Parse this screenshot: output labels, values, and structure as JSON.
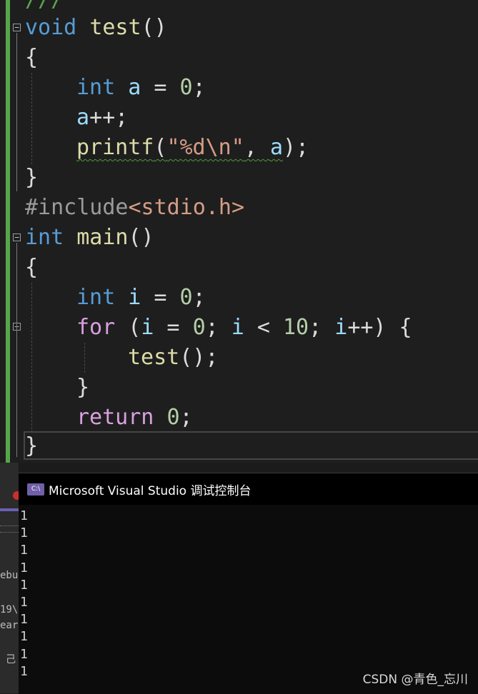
{
  "editor": {
    "top_fragment": "///",
    "code": {
      "l1": {
        "kw": "void",
        "fn": "test",
        "rest": "()"
      },
      "l2": "{",
      "l3": {
        "kw": "int",
        "var": "a",
        "op": " = ",
        "num": "0",
        "end": ";"
      },
      "l4": {
        "var": "a",
        "rest": "++;"
      },
      "l5": {
        "fn": "printf",
        "open": "(",
        "str": "\"%d\\n\"",
        "mid": ", ",
        "var": "a",
        "end": ");"
      },
      "l6": "}",
      "l7": {
        "pp": "#include",
        "inc": "<stdio.h>"
      },
      "l8": {
        "kw": "int",
        "fn": "main",
        "rest": "()"
      },
      "l9": "{",
      "l10": {
        "kw": "int",
        "var": "i",
        "op": " = ",
        "num": "0",
        "end": ";"
      },
      "l11": {
        "ctrl": "for",
        "open": " (",
        "v1": "i",
        "op1": " = ",
        "n1": "0",
        "s1": "; ",
        "v2": "i",
        "op2": " < ",
        "n2": "10",
        "s2": "; ",
        "v3": "i",
        "rest": "++) {"
      },
      "l12": {
        "fn": "test",
        "rest": "();"
      },
      "l13": "}",
      "l14": {
        "ctrl": "return",
        "sp": " ",
        "num": "0",
        "end": ";"
      },
      "l15": "}"
    }
  },
  "side_strip": {
    "lines": [
      "ebu",
      "19\\",
      "ear",
      "己"
    ]
  },
  "console": {
    "icon_label": "C:\\",
    "title": "Microsoft Visual Studio 调试控制台",
    "output": [
      "1",
      "1",
      "1",
      "1",
      "1",
      "1",
      "1",
      "1",
      "1",
      "1"
    ]
  },
  "watermark": "CSDN @青色_忘川",
  "colors": {
    "editor_bg": "#1e1e1e",
    "keyword": "#569cd6",
    "control": "#d8a0df",
    "function": "#dcdcaa",
    "variable": "#9cdcfe",
    "number": "#b5cea8",
    "string": "#d69d85",
    "console_bg": "#0c0c0c",
    "change_bar": "#57a64a"
  }
}
